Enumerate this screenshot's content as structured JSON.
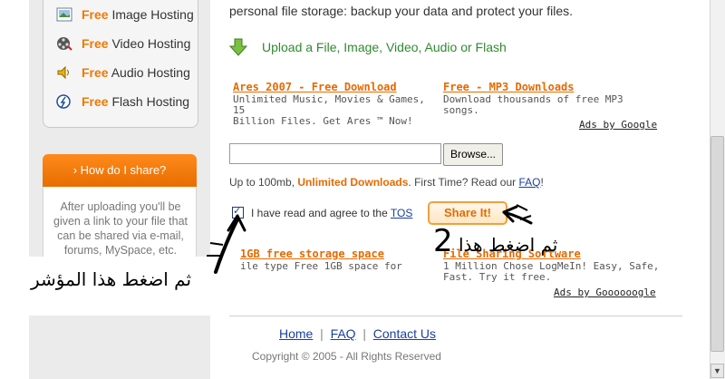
{
  "sidebar": {
    "hosting": [
      {
        "free": "Free",
        "label": "Image Hosting",
        "icon": "image-icon"
      },
      {
        "free": "Free",
        "label": "Video Hosting",
        "icon": "film-reel-icon"
      },
      {
        "free": "Free",
        "label": "Audio Hosting",
        "icon": "speaker-icon"
      },
      {
        "free": "Free",
        "label": "Flash Hosting",
        "icon": "flash-icon"
      }
    ],
    "how_header": "› How do I share?",
    "how_text": "After uploading you'll be given a link to your file that can be shared via e-mail, forums, MySpace, etc."
  },
  "main": {
    "intro": "personal file storage: backup your data and protect your files.",
    "upload_label": "Upload a File, Image, Video, Audio or Flash",
    "ads_top": [
      {
        "title": "Ares 2007 - Free Download",
        "line1": "Unlimited Music, Movies & Games, 15",
        "line2": "Billion Files. Get Ares ™ Now!"
      },
      {
        "title": "Free - MP3 Downloads",
        "line1": "Download thousands of free MP3 songs.",
        "line2": ""
      }
    ],
    "ads_by_top": "Ads by Google",
    "browse_label": "Browse...",
    "limit_prefix": "Up to 100mb,",
    "limit_highlight": "Unlimited Downloads",
    "limit_suffix": ". First Time? Read our",
    "faq_link": "FAQ",
    "limit_end": "!",
    "tos_text": "I have read and agree to the",
    "tos_link": "TOS",
    "share_label": "Share It!",
    "ads_bottom": [
      {
        "title": "1GB free storage space",
        "line1": "ile type Free 1GB space for",
        "line2": ""
      },
      {
        "title": "File Sharing Software",
        "line1": "1 Million Chose LogMeIn! Easy, Safe,",
        "line2": "Fast. Try it free."
      }
    ],
    "ads_by_bottom": "Ads by Goooooogle"
  },
  "annotations": {
    "step2_number": "2",
    "step2_text": "ثم اضغط هذا",
    "step1_text": "ثم اضغط هذا المؤشر"
  },
  "footer": {
    "links": [
      "Home",
      "FAQ",
      "Contact Us"
    ],
    "separator": "|",
    "copyright": "Copyright © 2005 - All Rights Reserved"
  },
  "colors": {
    "accent": "#f07800",
    "link": "#1a3fa0",
    "upload_green": "#2f8a2f"
  }
}
